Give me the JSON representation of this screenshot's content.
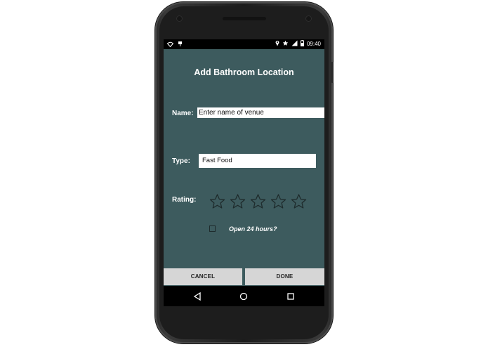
{
  "status_bar": {
    "time": "09:40",
    "left_icons": [
      "wifi-icon",
      "android-debug-icon"
    ],
    "right_icons": [
      "location-icon",
      "star-icon",
      "signal-icon",
      "battery-icon"
    ]
  },
  "form": {
    "title": "Add Bathroom Location",
    "name_label": "Name:",
    "name_placeholder": "Enter name of venue",
    "type_label": "Type:",
    "type_value": "Fast Food",
    "rating_label": "Rating:",
    "rating_max": 5,
    "rating_value": 0,
    "open24_label": "Open 24 hours?",
    "open24_checked": false
  },
  "buttons": {
    "cancel": "CANCEL",
    "done": "DONE"
  },
  "nav_bar": [
    "back-icon",
    "home-icon",
    "recents-icon"
  ],
  "colors": {
    "screen_bg": "#3d5b5e",
    "button_bg": "#d6d6d6",
    "star_stroke": "#1e2b2c"
  }
}
